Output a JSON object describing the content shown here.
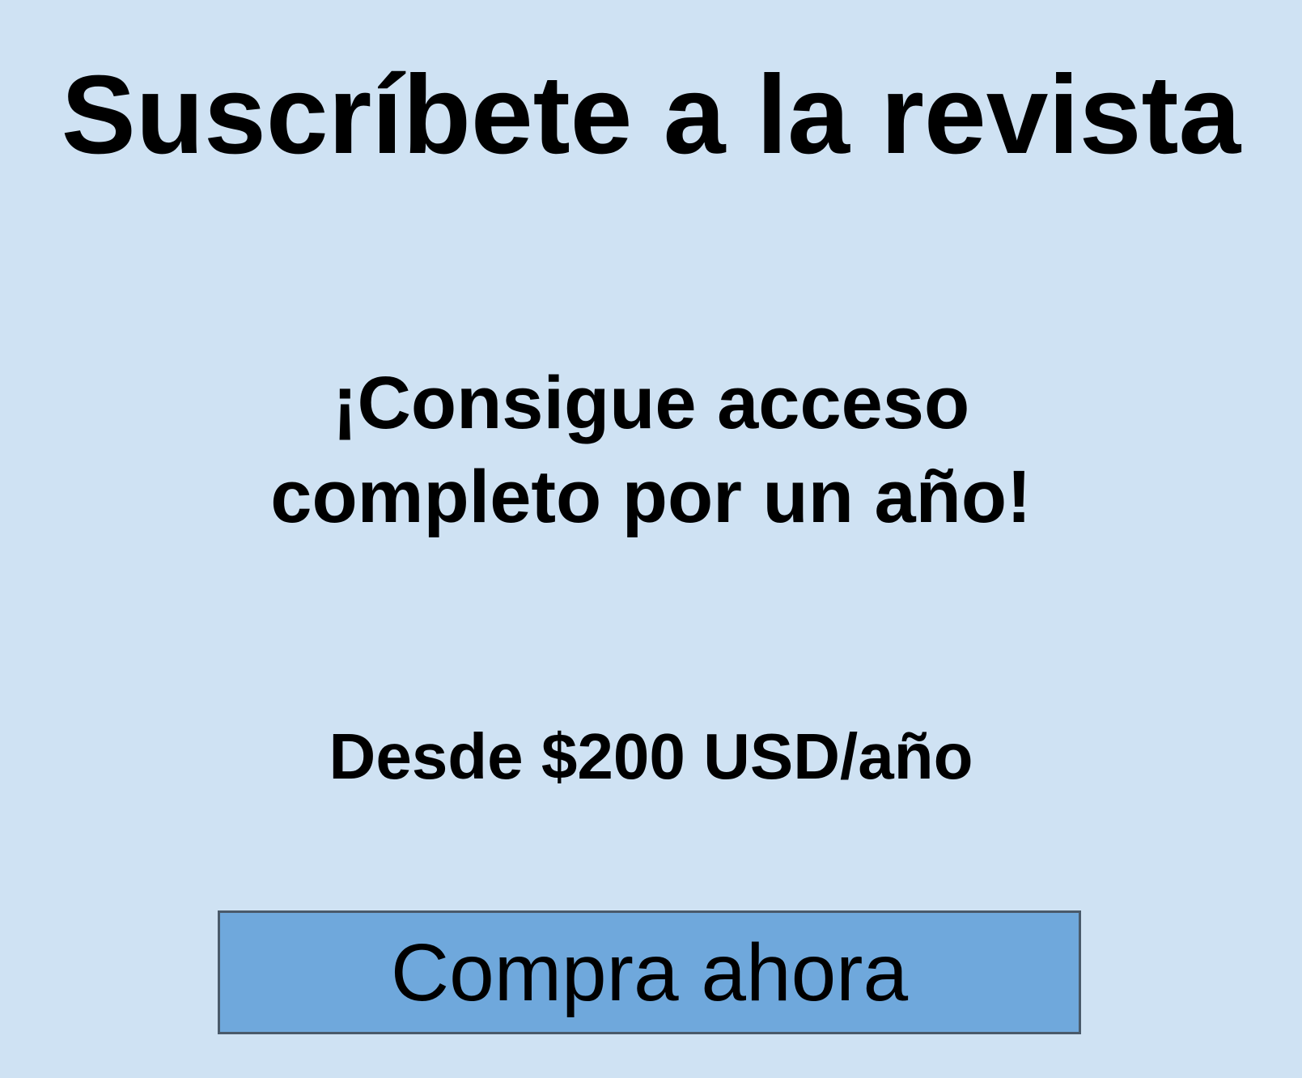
{
  "page": {
    "title": "Suscríbete a la revista",
    "tagline": "¡Consigue acceso completo por un año!",
    "price": "Desde $200 USD/año",
    "buy_button_label": "Compra ahora"
  },
  "colors": {
    "background": "#cfe2f3",
    "button_fill": "#6fa8dc",
    "button_border": "#4a5a6a",
    "text": "#000000"
  }
}
